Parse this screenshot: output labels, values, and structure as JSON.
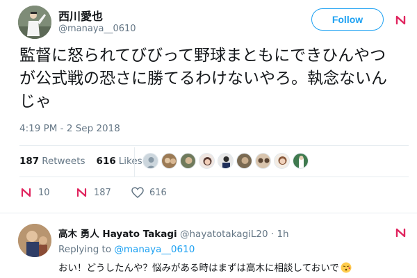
{
  "tweet": {
    "display_name": "西川愛也",
    "handle": "@manaya__0610",
    "follow_label": "Follow",
    "text": "監督に怒られてびびって野球まともにできひんやつが公式戦の恐さに勝てるわけないやろ。執念ないんじゃ",
    "timestamp": "4:19 PM - 2 Sep 2018",
    "retweets_count": "187",
    "retweets_label": "Retweets",
    "likes_count": "616",
    "likes_label": "Likes",
    "actions": {
      "reply_count": "10",
      "retweet_count": "187",
      "like_count": "616"
    }
  },
  "reply": {
    "display_name": "高木 勇人 Hayato Takagi",
    "handle": "@hayatotakagiL20",
    "separator": " · ",
    "time": "1h",
    "replying_prefix": "Replying to ",
    "replying_to": "@manaya__0610",
    "text": "おい！どうしたんや？悩みがある時はまずは高木に相談しておいで"
  },
  "colors": {
    "accent": "#1da1f2",
    "secondary_text": "#657786",
    "primary_text": "#14171a",
    "divider": "#e6ecf0",
    "caret_red": "#e0245e"
  },
  "icons": {
    "caret": "chevron-down-icon",
    "reply": "reply-icon",
    "retweet": "retweet-icon",
    "like": "heart-icon",
    "emoji": "kissing-face-emoji"
  }
}
